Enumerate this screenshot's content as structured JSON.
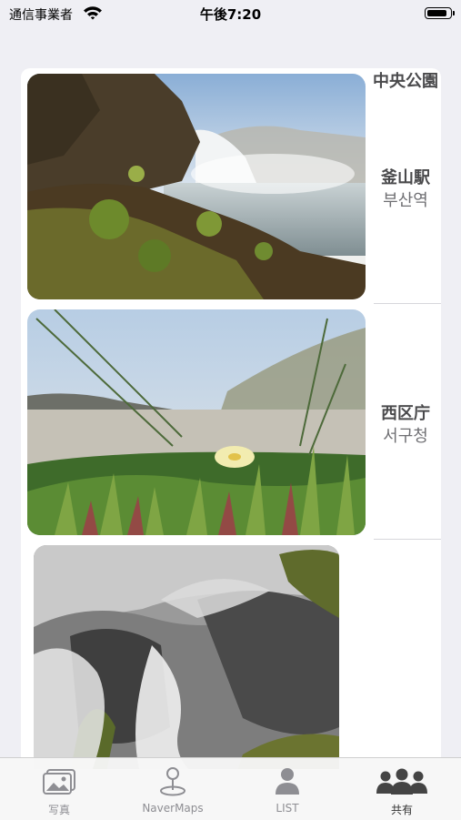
{
  "status_bar": {
    "carrier": "通信事業者",
    "time": "午後7:20",
    "battery_level": 0.9
  },
  "list": {
    "items": [
      {
        "title_ja": "釜山駅",
        "title_ko": "부산역",
        "image": "waterfall-photo"
      },
      {
        "title_ja": "西区庁",
        "title_ko": "서구청",
        "image": "coastal-flower-photo"
      },
      {
        "title_ja": "中央公園",
        "image": "stream-rocks-photo"
      }
    ]
  },
  "tab_bar": {
    "tabs": [
      {
        "label": "写真",
        "icon": "photos-icon",
        "selected": false
      },
      {
        "label": "NaverMaps",
        "icon": "map-pin-icon",
        "selected": false
      },
      {
        "label": "LIST",
        "icon": "person-icon",
        "selected": false
      },
      {
        "label": "共有",
        "icon": "group-icon",
        "selected": true
      }
    ]
  },
  "colors": {
    "background": "#efeff4",
    "card": "#ffffff",
    "tab_inactive": "#8e8e93",
    "tab_active": "#333333"
  }
}
